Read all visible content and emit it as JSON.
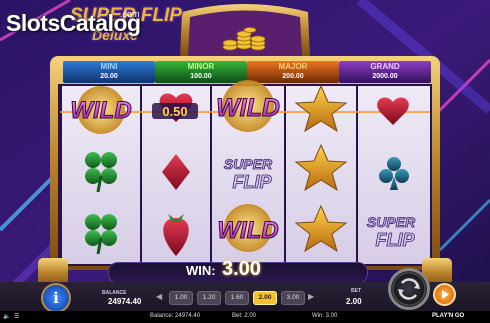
{
  "watermark": {
    "text": "SlotsCatalog",
    "suffix": ".com"
  },
  "game": {
    "title": "SUPER FLIP",
    "subtitle": "Deluxe"
  },
  "jackpots": [
    {
      "name": "MINI",
      "value": "20.00",
      "color": "#2f7bd8"
    },
    {
      "name": "MINOR",
      "value": "100.00",
      "color": "#36b63a"
    },
    {
      "name": "MAJOR",
      "value": "200.00",
      "color": "#f0741e"
    },
    {
      "name": "GRAND",
      "value": "2000.00",
      "color": "#8a3ec8"
    }
  ],
  "reels": {
    "symbols": [
      [
        "wild",
        "coin-value",
        "wild",
        "star",
        "heart"
      ],
      [
        "clover",
        "diamond",
        "super-flip",
        "star",
        "club"
      ],
      [
        "clover",
        "strawberry",
        "wild",
        "star",
        "super-flip"
      ]
    ],
    "wild_text": "WILD",
    "coin_value_text": "0.50",
    "super_text": "SUPER",
    "flip_text": "FLIP"
  },
  "win": {
    "label": "WIN:",
    "value": "3.00"
  },
  "panel": {
    "balance_label": "BALANCE",
    "balance_value": "24974.40",
    "bet_label": "BET",
    "bet_value": "2.00",
    "bet_options": [
      "1.00",
      "1.20",
      "1.60",
      "2.00",
      "3.00"
    ],
    "selected_bet": "2.00"
  },
  "status_bar": {
    "balance": "Balance: 24974.40",
    "bet": "Bet: 2.00",
    "win": "Win: 3.00",
    "provider": "PLAY'N GO"
  },
  "colors": {
    "gold": "#d9a13a",
    "accent_purple": "#3a1d6e",
    "win_glow": "#ffcc33"
  },
  "icons": [
    "info-icon",
    "spin-icon",
    "autoplay-icon",
    "arrow-left-icon",
    "arrow-right-icon",
    "volume-icon",
    "menu-icon"
  ]
}
